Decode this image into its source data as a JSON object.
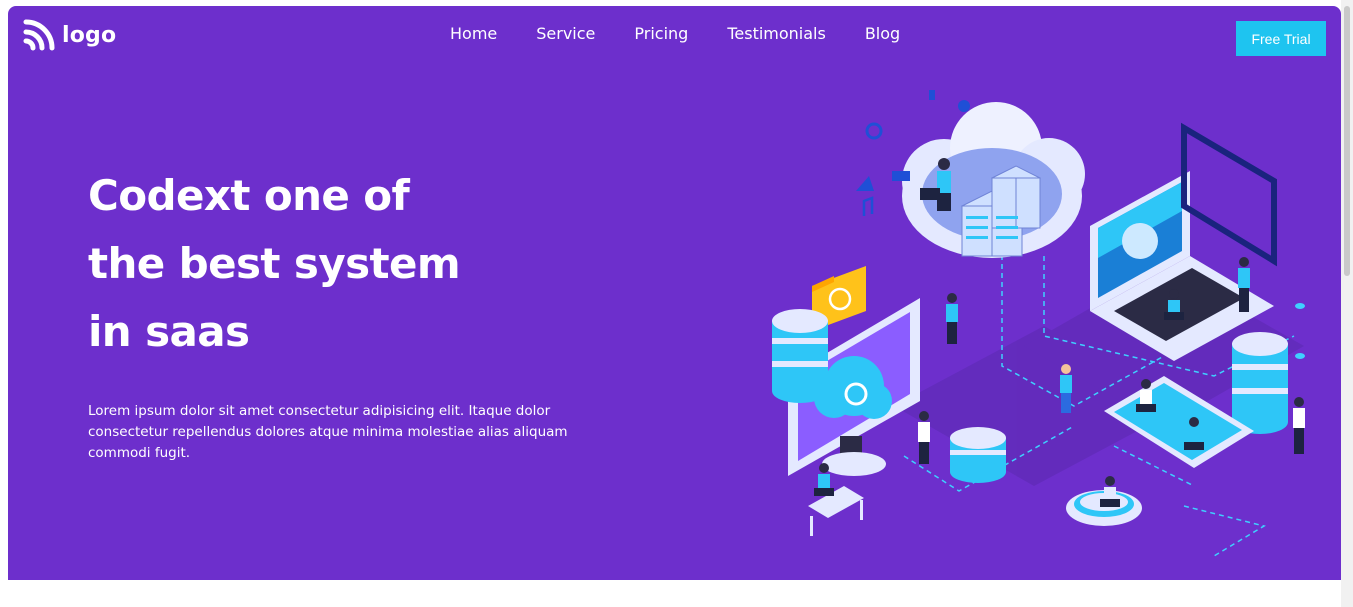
{
  "header": {
    "logo_text": "logo",
    "logo_icon": "rss-feed-icon",
    "nav": [
      {
        "label": "Home"
      },
      {
        "label": "Service"
      },
      {
        "label": "Pricing"
      },
      {
        "label": "Testimonials"
      },
      {
        "label": "Blog"
      }
    ],
    "cta_label": "Free Trial"
  },
  "hero": {
    "headline_lines": [
      "Codext one of",
      "the best system",
      "in saas"
    ],
    "body": "Lorem ipsum dolor sit amet consectetur adipisicing elit. Itaque dolor consectetur repellendus dolores atque minima molestiae alias aliquam commodi fugit.",
    "illustration": "isometric-cloud-computing-illustration"
  },
  "colors": {
    "hero_background": "#6d2fcc",
    "cta_background": "#1ec4f0",
    "text": "#ffffff",
    "illustration_accent": "#2ec6f7"
  }
}
